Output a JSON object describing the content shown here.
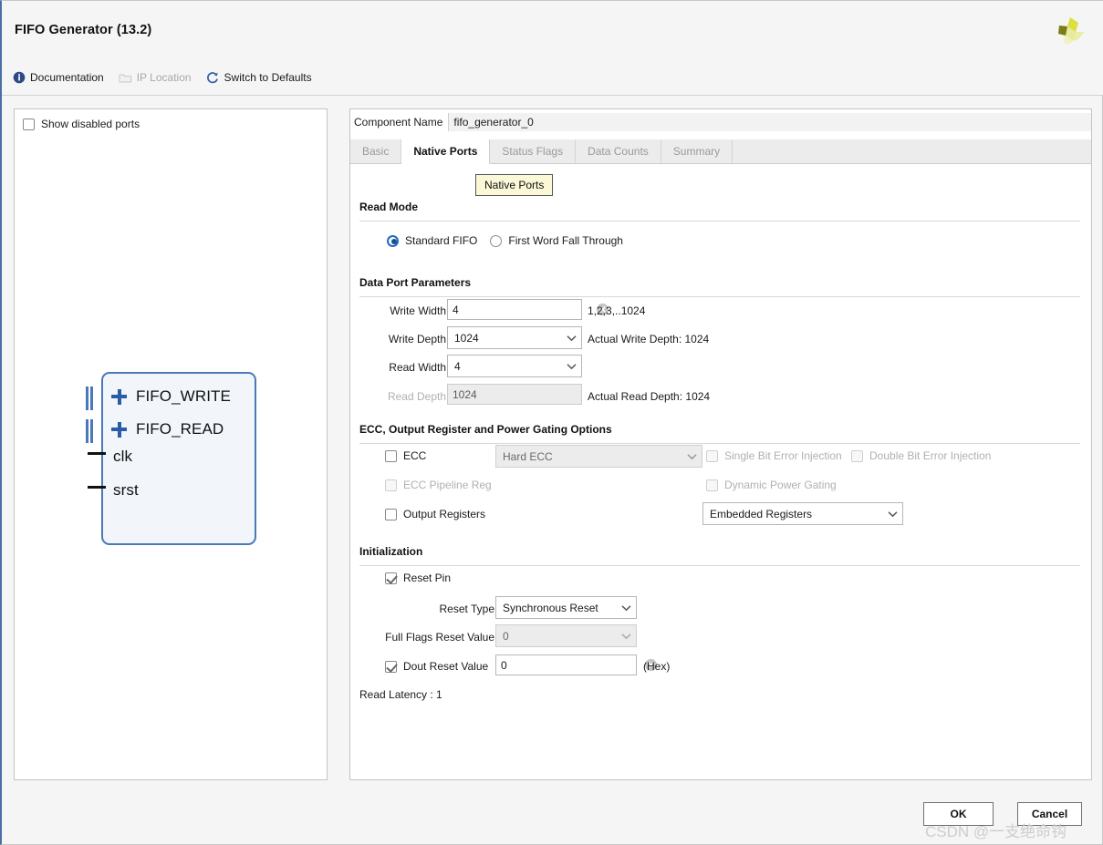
{
  "window": {
    "title": "FIFO Generator (13.2)",
    "brand_logo_icon": "xilinx-logo-icon"
  },
  "toolbar": {
    "items": [
      {
        "label": "Documentation",
        "icon": "info-icon",
        "enabled": true
      },
      {
        "label": "IP Location",
        "icon": "folder-icon",
        "enabled": false
      },
      {
        "label": "Switch to Defaults",
        "icon": "refresh-icon",
        "enabled": true
      }
    ]
  },
  "left_panel": {
    "show_disabled_ports": {
      "label": "Show disabled ports",
      "checked": false
    },
    "diagram": {
      "ports": [
        {
          "label": "FIFO_WRITE",
          "kind": "bus"
        },
        {
          "label": "FIFO_READ",
          "kind": "bus"
        },
        {
          "label": "clk",
          "kind": "pin"
        },
        {
          "label": "srst",
          "kind": "pin"
        }
      ]
    }
  },
  "component_name": {
    "label": "Component Name",
    "value": "fifo_generator_0"
  },
  "tabs": [
    {
      "label": "Basic",
      "active": false
    },
    {
      "label": "Native Ports",
      "active": true
    },
    {
      "label": "Status Flags",
      "active": false
    },
    {
      "label": "Data Counts",
      "active": false
    },
    {
      "label": "Summary",
      "active": false
    }
  ],
  "tooltip": {
    "text": "Native Ports"
  },
  "sections": {
    "read_mode": {
      "title": "Read Mode",
      "options": [
        {
          "label": "Standard FIFO",
          "selected": true
        },
        {
          "label": "First Word Fall Through",
          "selected": false
        }
      ]
    },
    "data_port_parameters": {
      "title": "Data Port Parameters",
      "write_width": {
        "label": "Write Width",
        "value": "4",
        "hint": "1,2,3,..1024"
      },
      "write_depth": {
        "label": "Write Depth",
        "value": "1024",
        "note": "Actual Write Depth: 1024"
      },
      "read_width": {
        "label": "Read Width",
        "value": "4"
      },
      "read_depth": {
        "label": "Read Depth",
        "value": "1024",
        "note": "Actual Read Depth: 1024"
      }
    },
    "ecc": {
      "title": "ECC, Output Register and Power Gating Options",
      "ecc_checkbox": {
        "label": "ECC",
        "checked": false,
        "enabled": true
      },
      "ecc_mode": {
        "value": "Hard ECC",
        "enabled": false
      },
      "single_bit_error_injection": {
        "label": "Single Bit Error Injection",
        "checked": false,
        "enabled": false
      },
      "double_bit_error_injection": {
        "label": "Double Bit Error Injection",
        "checked": false,
        "enabled": false
      },
      "ecc_pipeline_reg": {
        "label": "ECC Pipeline Reg",
        "checked": false,
        "enabled": false
      },
      "dynamic_power_gating": {
        "label": "Dynamic Power Gating",
        "checked": false,
        "enabled": false
      },
      "output_registers": {
        "label": "Output Registers",
        "checked": false,
        "enabled": true
      },
      "register_type": {
        "value": "Embedded Registers",
        "enabled": true
      }
    },
    "initialization": {
      "title": "Initialization",
      "reset_pin": {
        "label": "Reset Pin",
        "checked": true
      },
      "reset_type": {
        "label": "Reset Type",
        "value": "Synchronous Reset"
      },
      "full_flags_reset_value": {
        "label": "Full Flags Reset Value",
        "value": "0",
        "enabled": false
      },
      "dout_reset_value": {
        "label": "Dout Reset Value",
        "checked": true,
        "value": "0",
        "suffix": "(Hex)"
      },
      "read_latency": "Read Latency : 1"
    }
  },
  "footer": {
    "ok_label": "OK",
    "cancel_label": "Cancel"
  },
  "watermark": "CSDN @一支绝命钩",
  "colors": {
    "accent_blue": "#2167c4",
    "block_border": "#4a78b8",
    "tooltip_bg": "#fbf8d8"
  }
}
